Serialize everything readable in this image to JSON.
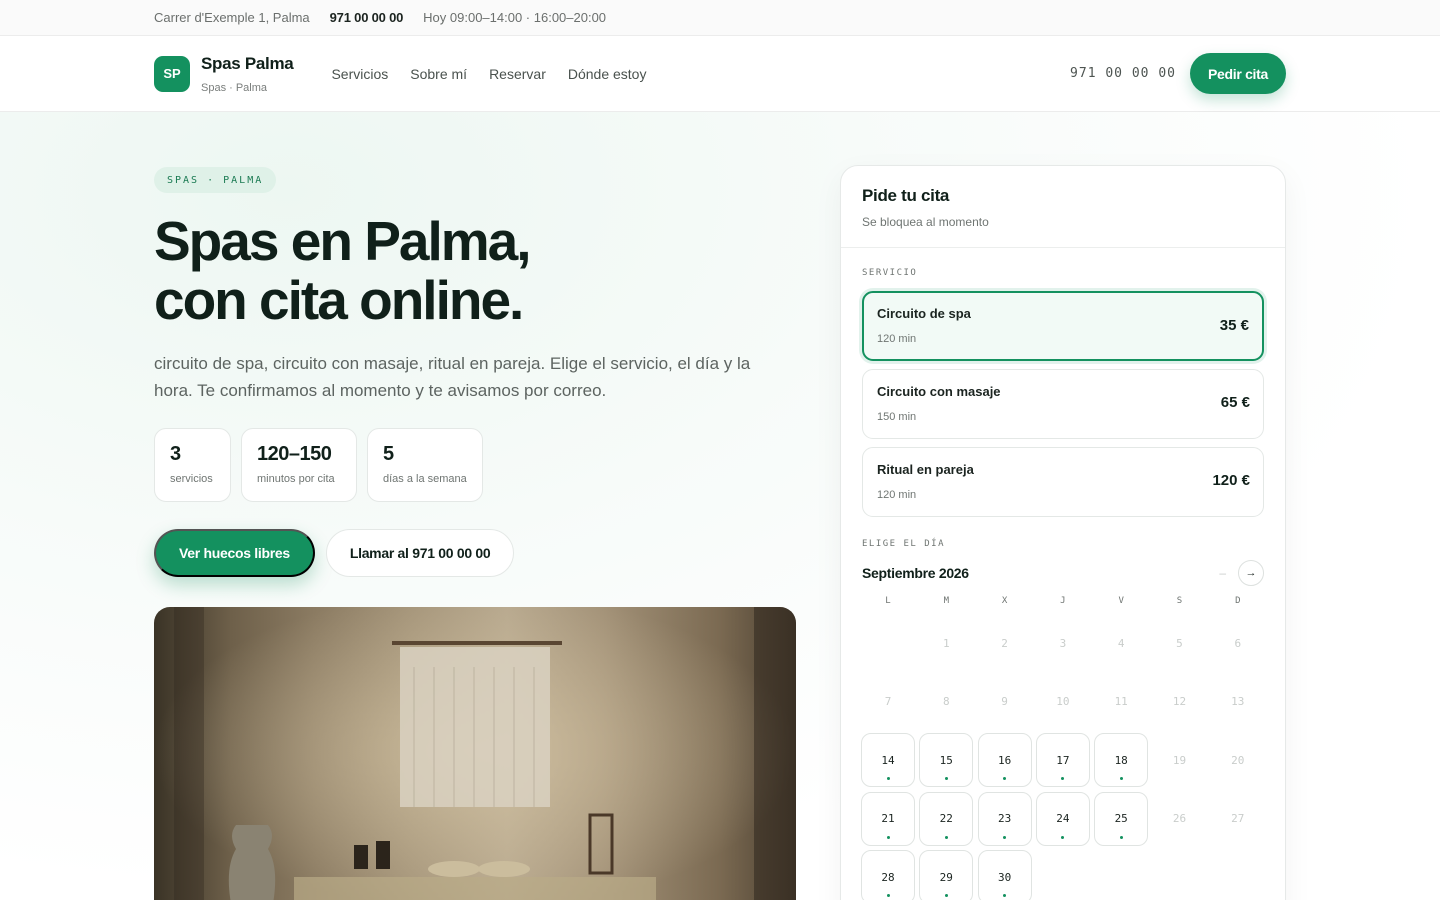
{
  "topbar": {
    "address": "Carrer d'Exemple 1, Palma",
    "phone": "971 00 00 00",
    "hours": "Hoy 09:00–14:00 · 16:00–20:00"
  },
  "header": {
    "logo": "SP",
    "brand_name": "Spas Palma",
    "brand_sub": "Spas · Palma",
    "nav": [
      "Servicios",
      "Sobre mí",
      "Reservar",
      "Dónde estoy"
    ],
    "phone": "971 00 00 00",
    "cta": "Pedir cita"
  },
  "hero": {
    "pill": "SPAS · PALMA",
    "title_line1": "Spas en Palma,",
    "title_line2": "con cita online.",
    "lead": "circuito de spa, circuito con masaje, ritual en pareja. Elige el servicio, el día y la hora. Te confirmamos al momento y te avisamos por correo.",
    "stats": [
      {
        "value": "3",
        "label": "servicios"
      },
      {
        "value": "120–150",
        "label": "minutos por cita"
      },
      {
        "value": "5",
        "label": "días a la semana"
      }
    ],
    "cta_primary": "Ver huecos libres",
    "cta_secondary": "Llamar al 971 00 00 00"
  },
  "booking": {
    "title": "Pide tu cita",
    "subtitle": "Se bloquea al momento",
    "service_label": "SERVICIO",
    "services": [
      {
        "name": "Circuito de spa",
        "duration": "120 min",
        "price": "35 €",
        "selected": true
      },
      {
        "name": "Circuito con masaje",
        "duration": "150 min",
        "price": "65 €",
        "selected": false
      },
      {
        "name": "Ritual en pareja",
        "duration": "120 min",
        "price": "120 €",
        "selected": false
      }
    ],
    "day_label": "ELIGE EL DÍA",
    "month": "Septiembre 2026",
    "prev_icon": "–",
    "next_icon": "→",
    "weekdays": [
      "L",
      "M",
      "X",
      "J",
      "V",
      "S",
      "D"
    ],
    "weeks": [
      [
        "",
        "1",
        "2",
        "3",
        "4",
        "5",
        "6"
      ],
      [
        "7",
        "8",
        "9",
        "10",
        "11",
        "12",
        "13"
      ],
      [
        "14",
        "15",
        "16",
        "17",
        "18",
        "19",
        "20"
      ],
      [
        "21",
        "22",
        "23",
        "24",
        "25",
        "26",
        "27"
      ],
      [
        "28",
        "29",
        "30",
        "",
        "",
        "",
        ""
      ]
    ],
    "available_days": [
      "14",
      "15",
      "16",
      "17",
      "18",
      "21",
      "22",
      "23",
      "24",
      "25",
      "28",
      "29",
      "30"
    ]
  },
  "colors": {
    "accent": "#14915f",
    "text": "#10201a"
  }
}
